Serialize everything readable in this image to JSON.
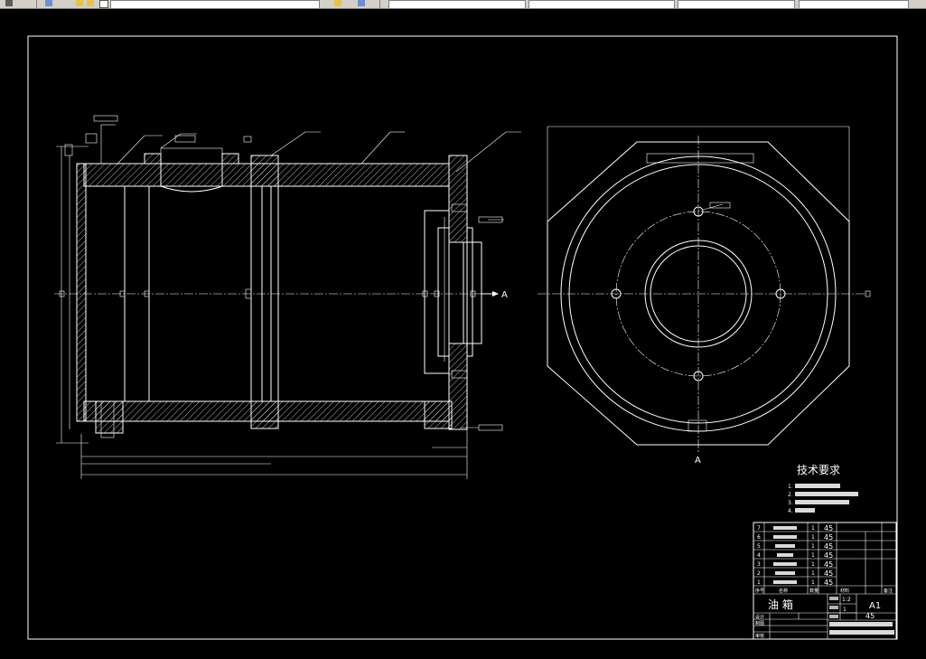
{
  "toolbar": {
    "layer_field": "",
    "field_a": "",
    "field_b": "",
    "field_c": "",
    "field_d": ""
  },
  "drawing": {
    "section_label": "A",
    "view_label": "A",
    "technical_requirements": {
      "title": "技术要求",
      "items": [
        "1. ",
        "2. ",
        "3. ",
        "4. "
      ]
    },
    "parts_list": {
      "rows": [
        {
          "no": "7",
          "name": "",
          "qty": "1",
          "material": "45"
        },
        {
          "no": "6",
          "name": "",
          "qty": "1",
          "material": "45"
        },
        {
          "no": "5",
          "name": "",
          "qty": "1",
          "material": "45"
        },
        {
          "no": "4",
          "name": "",
          "qty": "1",
          "material": "45"
        },
        {
          "no": "3",
          "name": "",
          "qty": "1",
          "material": "45"
        },
        {
          "no": "2",
          "name": "",
          "qty": "1",
          "material": "45"
        },
        {
          "no": "1",
          "name": "",
          "qty": "1",
          "material": "45"
        }
      ],
      "header": {
        "no": "序号",
        "name": "名称",
        "qty": "数量",
        "material": "材料",
        "note": "备注"
      }
    },
    "title_block": {
      "part_name": "油 箱",
      "sheet_size": "A1",
      "scale": "1:2",
      "material": "45",
      "qty": "1",
      "design": "设计",
      "drawn": "制图",
      "check": "审核"
    }
  }
}
